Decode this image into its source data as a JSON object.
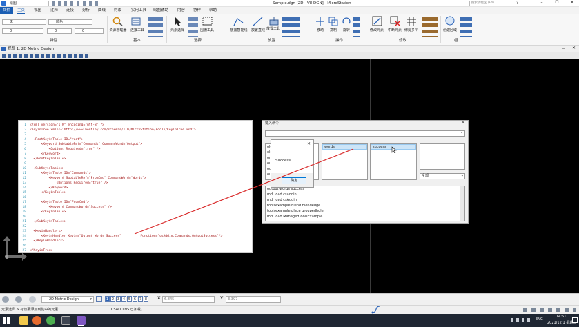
{
  "window": {
    "title": "Sample.dgn [2D - V8 DGN] - MicroStation",
    "workflow": "绘图",
    "search_placeholder": "搜索功能区 (F4)"
  },
  "menu": [
    "文件",
    "主页",
    "视图",
    "注释",
    "连接",
    "分析",
    "曲线",
    "约束",
    "实用工具",
    "绘图辅助",
    "内容",
    "协作",
    "帮助"
  ],
  "ribbon": {
    "level_combo": "无",
    "color_combo": "颜色",
    "weight_combo": "0",
    "style_combo": "0",
    "group_labels": [
      "特性",
      "基本",
      "选择",
      "放置",
      "操作",
      "修改",
      "组"
    ],
    "buttons": {
      "explorer": "资源管理器",
      "attach_tools": "连接工具",
      "element_select": "元素选择",
      "fence": "围栅工具",
      "smartline": "放置智能线",
      "place_line": "放置直线",
      "place_tool": "放置工具",
      "move": "移动",
      "copy": "复制",
      "rotate": "旋转",
      "scale": "缩放",
      "modify_element": "修改元素",
      "delete_element": "中断元素",
      "trim_multi": "修剪多个",
      "create_group": "创建区域"
    }
  },
  "view": {
    "title": "视图 1, 2D Metric Design"
  },
  "code_lines": [
    {
      "n": "1",
      "t": "<?xml version=\"1.0\" encoding=\"utf-8\" ?>"
    },
    {
      "n": "2",
      "t": "<KeyinTree xmlns=\"http://www.bentley.com/schemas/1.0/MicroStation/AddIn/KeyinTree.xsd\">"
    },
    {
      "n": "3",
      "t": ""
    },
    {
      "n": "4",
      "t": "  <RootKeyinTable ID=\"root\">"
    },
    {
      "n": "5",
      "t": "      <Keyword SubtableRef=\"Commands\" CommandWord=\"Output\">"
    },
    {
      "n": "6",
      "t": "          <Options Required=\"true\" />"
    },
    {
      "n": "7",
      "t": "      </Keyword>"
    },
    {
      "n": "8",
      "t": "  </RootKeyinTable>"
    },
    {
      "n": "9",
      "t": ""
    },
    {
      "n": "10",
      "t": "  <SubKeyinTables>"
    },
    {
      "n": "11",
      "t": "      <KeyinTable ID=\"Commands\">"
    },
    {
      "n": "12",
      "t": "          <Keyword SubtableRef=\"FromCmd\" CommandWord=\"Words\">"
    },
    {
      "n": "13",
      "t": "              <Options Required=\"true\" />"
    },
    {
      "n": "14",
      "t": "          </Keyword>"
    },
    {
      "n": "15",
      "t": "      </KeyinTable>"
    },
    {
      "n": "16",
      "t": ""
    },
    {
      "n": "17",
      "t": "      <KeyinTable ID=\"FromCmd\">"
    },
    {
      "n": "18",
      "t": "          <Keyword CommandWord=\"Success\" />"
    },
    {
      "n": "19",
      "t": "      </KeyinTable>"
    },
    {
      "n": "20",
      "t": ""
    },
    {
      "n": "21",
      "t": "  </SubKeyinTables>"
    },
    {
      "n": "22",
      "t": ""
    },
    {
      "n": "23",
      "t": "  <KeyinHandlers>"
    },
    {
      "n": "24",
      "t": "      <KeyinHandler Keyin=\"Output Words Success\"          Function=\"csAddin.Commands.OutputSuccess\"/>"
    },
    {
      "n": "25",
      "t": "  </KeyinHandlers>"
    },
    {
      "n": "26",
      "t": ""
    },
    {
      "n": "27",
      "t": "</KeyinTree>"
    }
  ],
  "keyin_dialog": {
    "title": "键入命令",
    "col1_items": [
      "ole",
      "ole",
      "orc",
      "out",
      "out",
      "out"
    ],
    "col2_selected": "words",
    "col3_selected": "success",
    "filter": "全部",
    "history": [
      "output words success",
      "mdl load csaddin",
      "mdl load csAddin",
      "toolsexample blend blendedge",
      "toolsexample place groupedhole",
      "mdl load ManagedToolsExample"
    ]
  },
  "message_box": {
    "text": "Success",
    "ok": "确定",
    "close": "✕"
  },
  "status": {
    "view_combo": "2D Metric Design",
    "view_buttons": [
      "1",
      "2",
      "3",
      "4",
      "5",
      "6",
      "7",
      "8"
    ],
    "x_label": "X",
    "x_value": "6.845",
    "y_label": "Y",
    "y_value": "3.397",
    "prompt": "元素选择 > 标识要添加到集中的元素",
    "message": "CSADDINS 已加载。"
  },
  "taskbar": {
    "lang": "ENG",
    "time": "14:51",
    "date": "2021/12/1 星期三"
  },
  "colors": {
    "accent": "#1b5eb3",
    "canvas": "#000000",
    "line": "#d92b2b"
  }
}
